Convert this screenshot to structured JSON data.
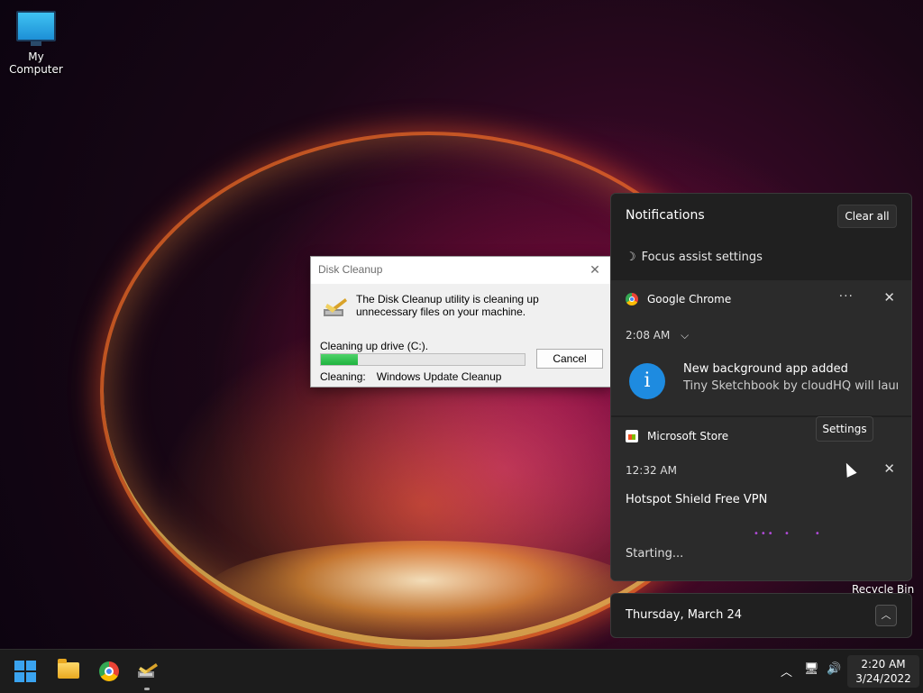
{
  "desktop": {
    "my_computer_label": "My Computer",
    "recycle_bin_label": "Recycle Bin"
  },
  "disk_cleanup": {
    "title": "Disk Cleanup",
    "message": "The Disk Cleanup utility is cleaning up unnecessary files on your machine.",
    "drive_text": "Cleaning up drive  (C:).",
    "progress_percent": 18,
    "cancel_label": "Cancel",
    "cleaning_label": "Cleaning:",
    "cleaning_value": "Windows Update Cleanup"
  },
  "notifications": {
    "header": "Notifications",
    "clear_all": "Clear all",
    "focus_assist": "Focus assist settings",
    "groups": [
      {
        "app": "Google Chrome",
        "time": "2:08 AM",
        "title": "New background app added",
        "body": "Tiny Sketchbook by cloudHQ will launch"
      },
      {
        "app": "Microsoft Store",
        "time": "12:32 AM",
        "title": "Hotspot Shield Free VPN",
        "status": "Starting..."
      }
    ],
    "tooltip": "Settings"
  },
  "calendar": {
    "date": "Thursday, March 24"
  },
  "taskbar": {
    "time": "2:20 AM",
    "date": "3/24/2022"
  },
  "colors": {
    "accent": "#1e8be0",
    "progress": "#1fb33e",
    "panel_bg": "#202020"
  }
}
